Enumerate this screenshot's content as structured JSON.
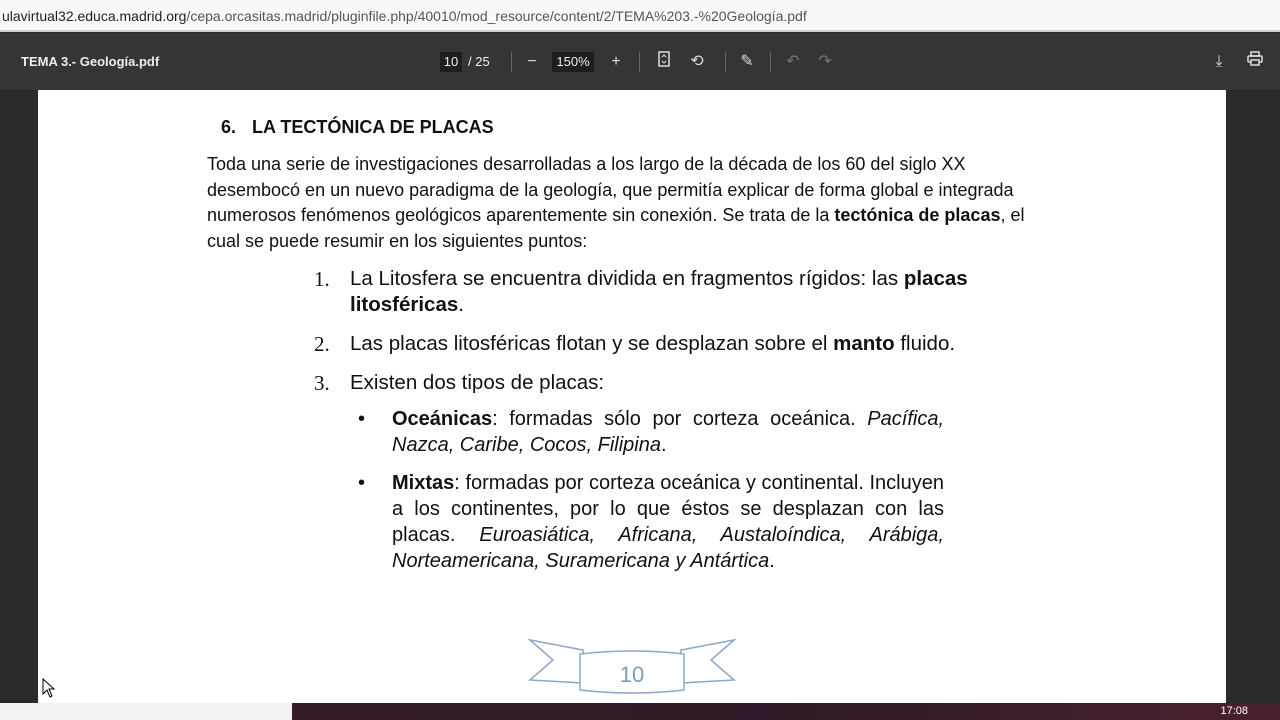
{
  "browser": {
    "url_host": "ulavirtual32.educa.madrid.org",
    "url_path": "/cepa.orcasitas.madrid/pluginfile.php/40010/mod_resource/content/2/TEMA%203.-%20Geología.pdf"
  },
  "toolbar": {
    "title": "TEMA 3.- Geología.pdf",
    "page_current": "10",
    "page_total": "/ 25",
    "zoom": "150%",
    "icons": [
      "zoom-out",
      "zoom-in",
      "fit-page",
      "rotate",
      "draw",
      "undo",
      "redo",
      "download",
      "print"
    ]
  },
  "doc": {
    "heading_num": "6.",
    "heading": "LA TECTÓNICA DE PLACAS",
    "intro_1": "Toda una serie de investigaciones desarrolladas a los largo de la década de los 60 del siglo XX desembocó en un nuevo paradigma de la geología, que permitía explicar de forma global e integrada numerosos fenómenos geológicos aparentemente sin conexión. Se trata de la ",
    "intro_bold": "tectónica de placas",
    "intro_2": ", el cual se puede resumir en los siguientes puntos:",
    "items": [
      {
        "n": "1.",
        "a": "La Litosfera se encuentra dividida en fragmentos rígidos: las ",
        "b": "placas litosféricas",
        "c": "."
      },
      {
        "n": "2.",
        "a": "Las placas litosféricas flotan y se desplazan sobre el ",
        "b": "manto",
        "c": " fluido."
      },
      {
        "n": "3.",
        "a": "Existen dos tipos de placas:"
      }
    ],
    "bullets": [
      {
        "b": "Oceánicas",
        "a": ": formadas sólo por corteza oceánica. ",
        "i": "Pacífica, Nazca, Caribe, Cocos, Filipina",
        "c": "."
      },
      {
        "b": "Mixtas",
        "a": ": formadas por corteza oceánica y continental. Incluyen a los continentes, por lo que éstos se desplazan con las placas. ",
        "i": "Euroasiática, Africana, Austaloíndica, Arábiga, Norteamericana, Suramericana y Antártica",
        "c": "."
      }
    ],
    "page_number": "10"
  },
  "taskbar": {
    "clock": "17:08"
  }
}
